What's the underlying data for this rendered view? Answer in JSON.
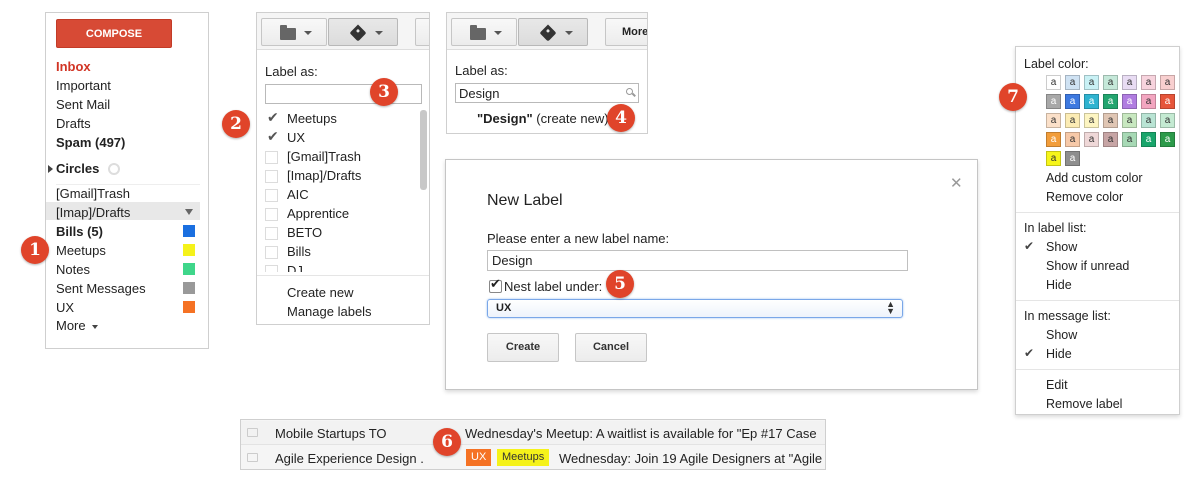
{
  "sidebar": {
    "compose": "COMPOSE",
    "items": [
      "Inbox",
      "Important",
      "Sent Mail",
      "Drafts",
      "Spam (497)"
    ],
    "circles": "Circles",
    "labels": [
      {
        "label": "[Gmail]Trash",
        "color": ""
      },
      {
        "label": "[Imap]/Drafts",
        "color": ""
      },
      {
        "label": "Bills (5)",
        "color": "#1a6fe0"
      },
      {
        "label": "Meetups",
        "color": "#f5f21a"
      },
      {
        "label": "Notes",
        "color": "#3fd68a"
      },
      {
        "label": "Sent Messages",
        "color": "#999999"
      },
      {
        "label": "UX",
        "color": "#f57224"
      }
    ],
    "more": "More"
  },
  "label_menu": {
    "heading": "Label as:",
    "search_value": "",
    "items": [
      {
        "label": "Meetups",
        "checked": true
      },
      {
        "label": "UX",
        "checked": true
      },
      {
        "label": "[Gmail]Trash",
        "checked": false
      },
      {
        "label": "[Imap]/Drafts",
        "checked": false
      },
      {
        "label": "AIC",
        "checked": false
      },
      {
        "label": "Apprentice",
        "checked": false
      },
      {
        "label": "BETO",
        "checked": false
      },
      {
        "label": "Bills",
        "checked": false
      },
      {
        "label": "DJ",
        "checked": false
      }
    ],
    "create_new": "Create new",
    "manage_labels": "Manage labels"
  },
  "label_search": {
    "heading": "Label as:",
    "search_value": "Design",
    "more_button": "More",
    "create_bold": "\"Design\"",
    "create_suffix": " (create new)"
  },
  "new_label_dialog": {
    "title": "New Label",
    "close": "✕",
    "prompt": "Please enter a new label name:",
    "name_value": "Design",
    "nest_label": "Nest label under:",
    "nest_checked": true,
    "parent_value": "UX",
    "create_button": "Create",
    "cancel_button": "Cancel"
  },
  "email_list": [
    {
      "sender": "Mobile Startups TO",
      "labels": [],
      "subject": "Wednesday's Meetup: A waitlist is available for \"Ep #17 Case"
    },
    {
      "sender": "Agile Experience Design .",
      "labels": [
        {
          "text": "UX",
          "bg": "#f57224",
          "fg": "#ffffff"
        },
        {
          "text": "Meetups",
          "bg": "#f5f21a",
          "fg": "#333333"
        }
      ],
      "subject": "Wednesday: Join 19 Agile Designers at \"Agile"
    }
  ],
  "color_menu": {
    "heading": "Label color:",
    "swatch_letter": "a",
    "palette": [
      [
        {
          "bg": "#ffffff",
          "fg": "#333"
        },
        {
          "bg": "#cfe2f3",
          "fg": "#333"
        },
        {
          "bg": "#c9f1f5",
          "fg": "#333"
        },
        {
          "bg": "#c5e8d9",
          "fg": "#333"
        },
        {
          "bg": "#e8dcf3",
          "fg": "#333"
        },
        {
          "bg": "#f7d3dd",
          "fg": "#333"
        },
        {
          "bg": "#f8cfcf",
          "fg": "#333"
        }
      ],
      [
        {
          "bg": "#a8a8a8",
          "fg": "#fff"
        },
        {
          "bg": "#3d79e0",
          "fg": "#fff"
        },
        {
          "bg": "#2fb3d0",
          "fg": "#fff"
        },
        {
          "bg": "#23a56f",
          "fg": "#fff"
        },
        {
          "bg": "#b07de0",
          "fg": "#fff"
        },
        {
          "bg": "#f3a6c0",
          "fg": "#333"
        },
        {
          "bg": "#e6553a",
          "fg": "#fff"
        }
      ],
      [
        {
          "bg": "#fbe0c9",
          "fg": "#333"
        },
        {
          "bg": "#fcecb4",
          "fg": "#333"
        },
        {
          "bg": "#fdf5c2",
          "fg": "#333"
        },
        {
          "bg": "#e0c6b4",
          "fg": "#333"
        },
        {
          "bg": "#c8e8c0",
          "fg": "#333"
        },
        {
          "bg": "#b9e4d4",
          "fg": "#333"
        },
        {
          "bg": "#c4ead2",
          "fg": "#333"
        }
      ],
      [
        {
          "bg": "#f29d3a",
          "fg": "#fff"
        },
        {
          "bg": "#f7c9a8",
          "fg": "#333"
        },
        {
          "bg": "#efd8d8",
          "fg": "#333"
        },
        {
          "bg": "#c7a5a5",
          "fg": "#333"
        },
        {
          "bg": "#a7d9b5",
          "fg": "#333"
        },
        {
          "bg": "#19a56b",
          "fg": "#fff"
        },
        {
          "bg": "#2c9a4a",
          "fg": "#fff"
        }
      ],
      [
        {
          "bg": "#f6f51a",
          "fg": "#333"
        },
        {
          "bg": "#8e8e8e",
          "fg": "#fff"
        }
      ]
    ],
    "add_custom": "Add custom color",
    "remove_color": "Remove color",
    "in_label_list": "In label list:",
    "label_list_options": [
      {
        "label": "Show",
        "checked": true
      },
      {
        "label": "Show if unread",
        "checked": false
      },
      {
        "label": "Hide",
        "checked": false
      }
    ],
    "in_message_list": "In message list:",
    "message_list_options": [
      {
        "label": "Show",
        "checked": false
      },
      {
        "label": "Hide",
        "checked": true
      }
    ],
    "edit": "Edit",
    "remove_label": "Remove label"
  },
  "badges": [
    "1",
    "2",
    "3",
    "4",
    "5",
    "6",
    "7"
  ],
  "colors": {
    "accent": "#dd4b39",
    "badge": "#e0442a",
    "inbox_red": "#d13424"
  }
}
